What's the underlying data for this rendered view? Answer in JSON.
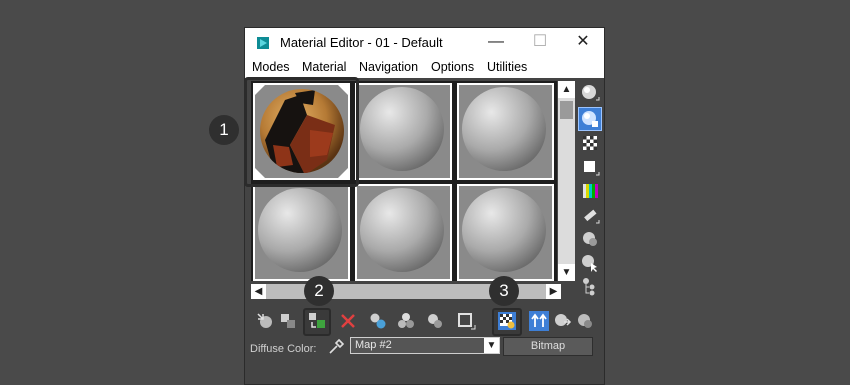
{
  "window": {
    "title": "Material Editor - 01 - Default",
    "minimize_glyph": "—",
    "maximize_glyph": "☐",
    "close_glyph": "✕"
  },
  "menu": {
    "items": [
      {
        "label": "Modes"
      },
      {
        "label": "Material"
      },
      {
        "label": "Navigation"
      },
      {
        "label": "Options"
      },
      {
        "label": "Utilities"
      }
    ]
  },
  "slots": {
    "count": 6,
    "active_index": 0
  },
  "scroll": {
    "up": "▲",
    "down": "▼",
    "left": "◀",
    "right": "▶"
  },
  "sidebar": {
    "icons": [
      "sample-type-icon",
      "backlight-icon",
      "background-icon",
      "sample-uv-tiling-icon",
      "video-color-check-icon",
      "make-preview-icon",
      "options-icon",
      "select-by-material-icon",
      "material-map-navigator-icon"
    ]
  },
  "toolbar": {
    "icons": [
      "get-material-icon",
      "put-material-icon",
      "assign-material-icon",
      "reset-map-icon",
      "make-unique-icon",
      "put-to-library-icon",
      "material-id-channel-icon",
      "show-shaded-icon",
      "show-end-result-icon",
      "go-to-parent-icon",
      "go-forward-sibling-icon"
    ]
  },
  "bottom": {
    "diffuse_label": "Diffuse Color:",
    "map_value": "Map #2",
    "dropdown_glyph": "▼",
    "bitmap_label": "Bitmap"
  },
  "badges": {
    "one": "1",
    "two": "2",
    "three": "3"
  },
  "colors": {
    "background": "#4a4a4a",
    "titlebar": "#ffffff",
    "panel": "#444444",
    "slot_gray": "#8a8a8a",
    "badge": "#2f2f2f",
    "delete_red": "#e04040"
  }
}
